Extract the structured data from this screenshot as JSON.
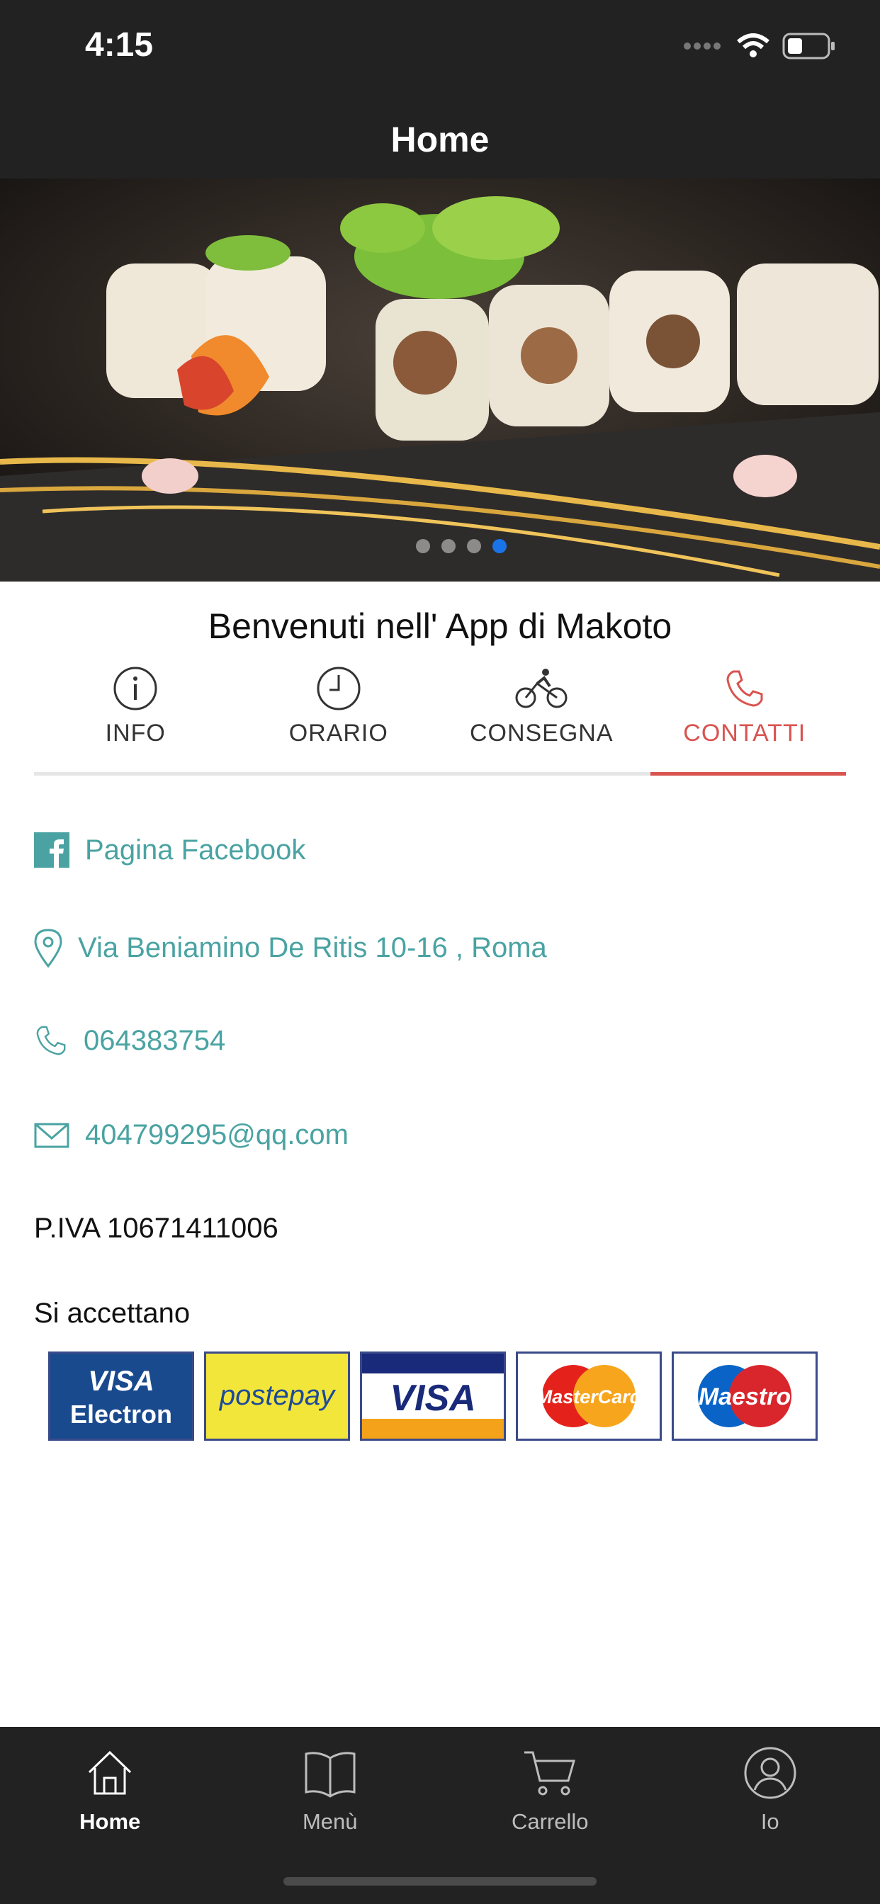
{
  "status_bar": {
    "time": "4:15"
  },
  "nav": {
    "title": "Home"
  },
  "carousel": {
    "dot_count": 4,
    "active_index": 3
  },
  "welcome": "Benvenuti nell' App di Makoto",
  "tabs": [
    {
      "label": "INFO",
      "icon": "info-icon"
    },
    {
      "label": "ORARIO",
      "icon": "clock-icon"
    },
    {
      "label": "CONSEGNA",
      "icon": "bicycle-icon"
    },
    {
      "label": "CONTATTI",
      "icon": "phone-icon",
      "active": true
    }
  ],
  "contacts": {
    "facebook": "Pagina Facebook",
    "address": "Via Beniamino De Ritis 10-16 , Roma",
    "phone": "064383754",
    "email": "404799295@qq.com"
  },
  "piva": "P.IVA 10671411006",
  "payments": {
    "title": "Si accettano",
    "cards": [
      "VISA Electron",
      "postepay",
      "VISA",
      "MasterCard",
      "Maestro"
    ]
  },
  "tabbar": [
    {
      "label": "Home",
      "icon": "home-icon",
      "active": true
    },
    {
      "label": "Menù",
      "icon": "book-icon"
    },
    {
      "label": "Carrello",
      "icon": "cart-icon"
    },
    {
      "label": "Io",
      "icon": "user-icon"
    }
  ],
  "colors": {
    "accent_red": "#d9534f",
    "link_teal": "#4aa3a2",
    "bar_dark": "#222222",
    "dot_active": "#1a73e8"
  }
}
